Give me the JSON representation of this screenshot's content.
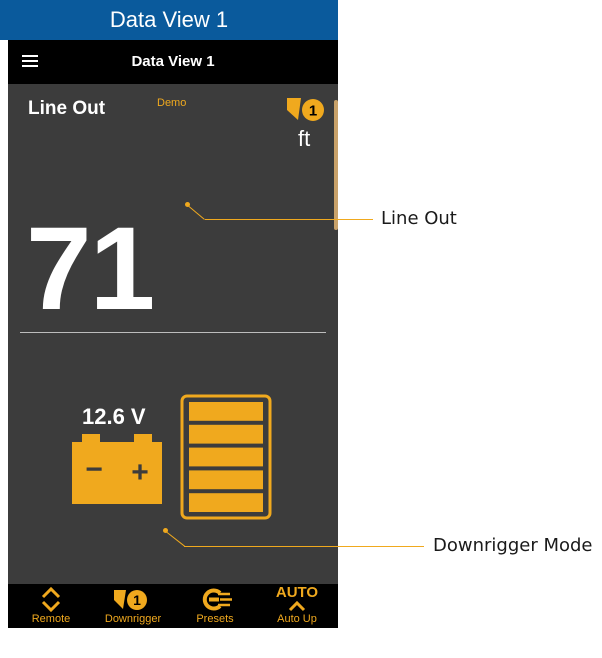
{
  "figure_caption": "Data View 1",
  "appbar": {
    "title": "Data View 1",
    "menu_icon": "hamburger-menu-icon"
  },
  "gauge": {
    "label": "Line Out",
    "demo_tag": "Demo",
    "downrigger_badge": "1",
    "unit": "ft",
    "value": "71"
  },
  "battery": {
    "voltage": "12.6 V",
    "minus_sign": "−",
    "plus_sign": "+",
    "charge_segments_filled": 5,
    "charge_segments_total": 5
  },
  "bottom_nav": {
    "remote_label": "Remote",
    "downrigger_label": "Downrigger",
    "downrigger_badge": "1",
    "presets_label": "Presets",
    "auto_text": "AUTO",
    "autoup_label": "Auto Up"
  },
  "callouts": {
    "line_out": "Line Out",
    "downrigger_mode": "Downrigger Mode"
  },
  "colors": {
    "accent": "#f0a91e",
    "screen_bg": "#3c3c3c",
    "bar_bg": "#000000",
    "caption_bg": "#0a5a9c"
  }
}
